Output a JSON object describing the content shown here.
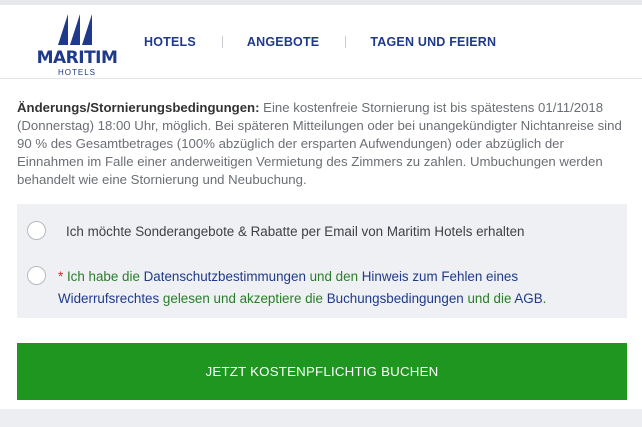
{
  "brand": {
    "name": "MARITIM",
    "sub": "HOTELS",
    "color": "#1f3a8a"
  },
  "nav": {
    "items": [
      {
        "label": "HOTELS"
      },
      {
        "label": "ANGEBOTE"
      },
      {
        "label": "TAGEN UND FEIERN"
      }
    ]
  },
  "policy": {
    "heading": "Änderungs/Stornierungsbedingungen:",
    "text": " Eine kostenfreie Stornierung ist bis spätestens 01/11/2018 (Donnerstag) 18:00 Uhr, möglich. Bei späteren Mitteilungen oder bei unangekündigter Nichtanreise sind 90 % des Gesamtbetrages (100% abzüglich der ersparten Aufwendungen) oder abzüglich der Einnahmen im Falle einer anderweitigen Vermietung des Zimmers zu zahlen. Umbuchungen werden behandelt wie eine Stornierung und Neubuchung."
  },
  "options": {
    "newsletter": {
      "label": "Ich möchte Sonderangebote & Rabatte per Email von Maritim Hotels erhalten",
      "checked": false
    },
    "terms": {
      "required_mark": "* ",
      "part1": "Ich habe die ",
      "link1": "Datenschutzbestimmungen",
      "part2": " und den ",
      "link2": "Hinweis zum Fehlen eines Widerrufsrechtes",
      "part3": " gelesen und akzeptiere die ",
      "link3": "Buchungsbedingungen",
      "part4": " und die ",
      "link4": "AGB",
      "part5": ".",
      "checked": false
    }
  },
  "book_button": {
    "label": "JETZT KOSTENPFLICHTIG BUCHEN",
    "color": "#1f961f"
  }
}
